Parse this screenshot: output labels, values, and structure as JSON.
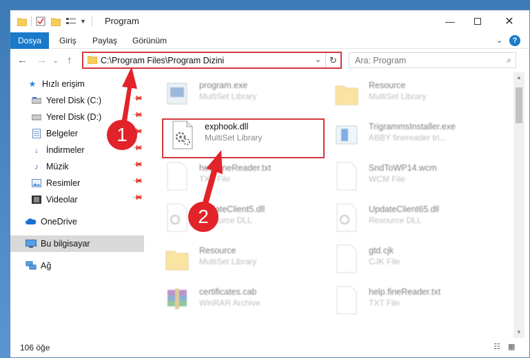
{
  "window": {
    "title": "Program"
  },
  "ribbon": {
    "tabs": [
      "Dosya",
      "Giriş",
      "Paylaş",
      "Görünüm"
    ]
  },
  "nav": {
    "address": "C:\\Program Files\\Program Dizini",
    "search_placeholder": "Ara: Program"
  },
  "sidebar": {
    "items": [
      {
        "label": "Hızlı erişim",
        "icon": "star-icon"
      },
      {
        "label": "Yerel Disk (C:)",
        "icon": "drive-icon"
      },
      {
        "label": "Yerel Disk (D:)",
        "icon": "drive-icon"
      },
      {
        "label": "Belgeler",
        "icon": "documents-icon"
      },
      {
        "label": "İndirmeler",
        "icon": "download-icon"
      },
      {
        "label": "Müzik",
        "icon": "music-icon"
      },
      {
        "label": "Resimler",
        "icon": "pictures-icon"
      },
      {
        "label": "Videolar",
        "icon": "video-icon"
      },
      {
        "label": "OneDrive",
        "icon": "cloud-icon"
      },
      {
        "label": "Bu bilgisayar",
        "icon": "computer-icon"
      },
      {
        "label": "Ağ",
        "icon": "network-icon"
      }
    ]
  },
  "files": [
    {
      "name": "program.exe",
      "type": "MultiSet Library"
    },
    {
      "name": "Resource",
      "type": "MultiSet Library"
    },
    {
      "name": "exphook.dll",
      "type": "MultiSet Library"
    },
    {
      "name": "TrigrammsInstaller.exe",
      "type": "ABBY finereader tri..."
    },
    {
      "name": "help.fineReader.txt",
      "type": "TXT File"
    },
    {
      "name": "SndToWP14.wcm",
      "type": "WCM File"
    },
    {
      "name": "UpdateClient5.dll",
      "type": "Resource DLL"
    },
    {
      "name": "UpdateClient65.dll",
      "type": "Resource DLL"
    },
    {
      "name": "Resource",
      "type": "MultiSet Library"
    },
    {
      "name": "gtd.cjk",
      "type": "CJK File"
    },
    {
      "name": "certificates.cab",
      "type": "WinRAR Archive"
    },
    {
      "name": "help.fineReader.txt",
      "type": "TXT File"
    }
  ],
  "status": {
    "count": "106 öğe"
  },
  "annotations": {
    "step1": "1",
    "step2": "2"
  },
  "colors": {
    "accent": "#1979ca",
    "highlight": "#d4363c",
    "badge": "#e2232a"
  }
}
